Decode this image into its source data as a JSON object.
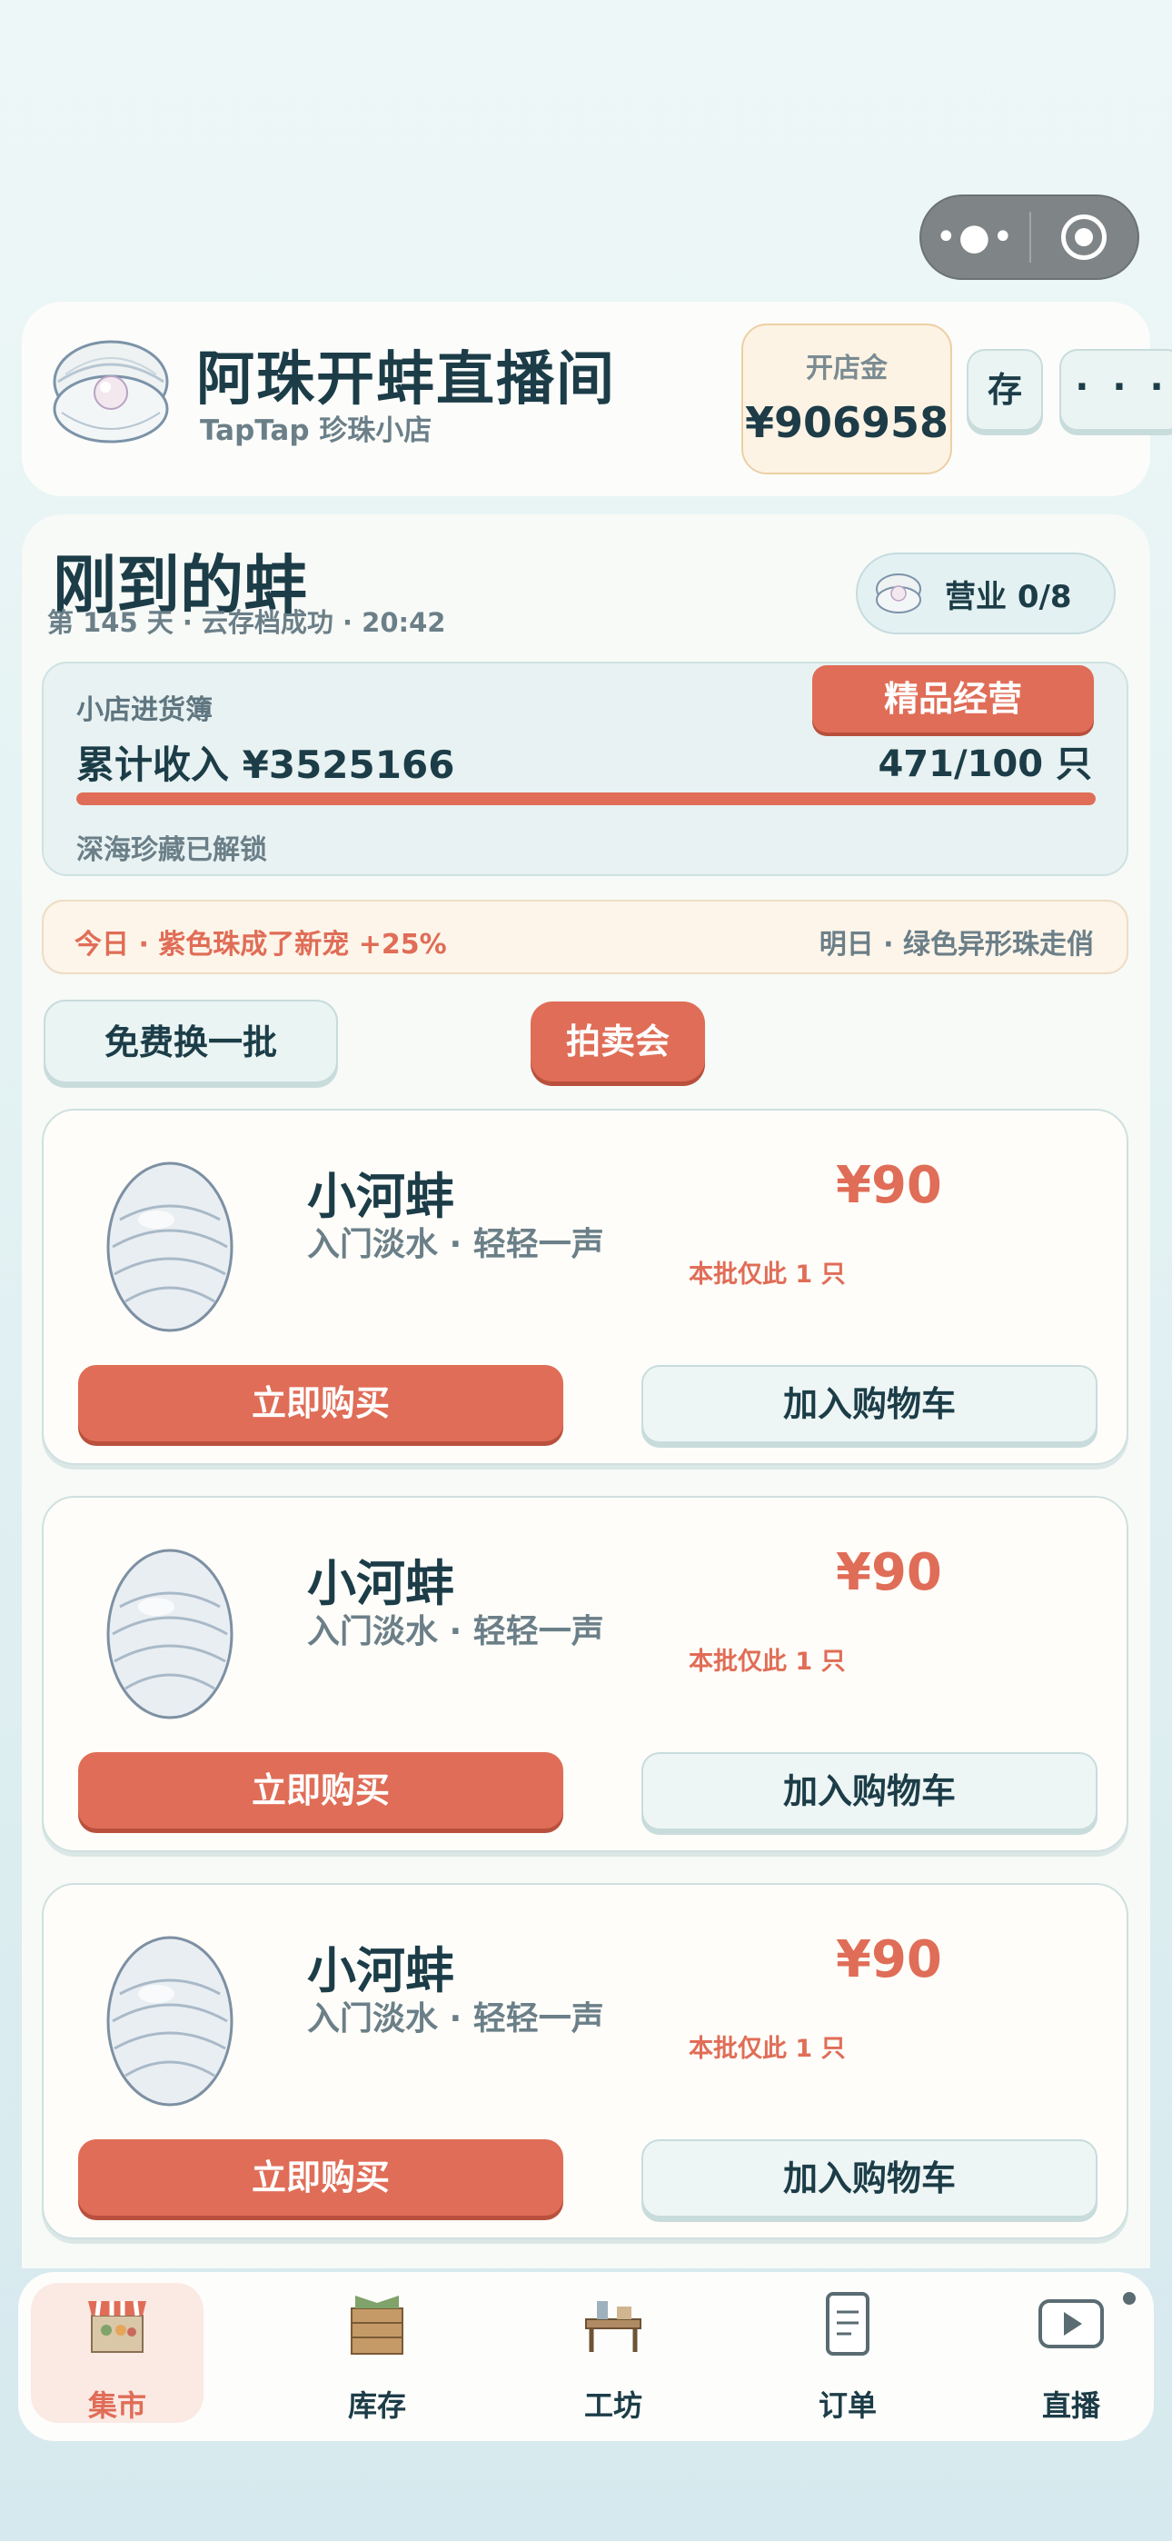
{
  "header": {
    "shop_title": "阿珠开蚌直播间",
    "shop_subtitle": "TapTap 珍珠小店",
    "gold_label": "开店金",
    "gold_value": "¥906958",
    "save_label": "存",
    "more_label": "· · ·"
  },
  "main": {
    "title": "刚到的蚌",
    "subtitle": "第 145 天 · 云存档成功 · 20:42",
    "business_badge": "营业 0/8"
  },
  "ledger": {
    "title": "小店进货簿",
    "income": "累计收入 ¥3525166",
    "tag": "精品经营",
    "count": "471/100 只",
    "progress": 1.0,
    "unlock_note": "深海珍藏已解锁"
  },
  "news": {
    "today": "今日 · 紫色珠成了新宠 +25%",
    "tomorrow": "明日 · 绿色异形珠走俏"
  },
  "actions": {
    "swap_label": "免费换一批",
    "auction_label": "拍卖会"
  },
  "items": [
    {
      "name": "小河蚌",
      "desc": "入门淡水 · 轻轻一声",
      "price": "¥90",
      "stock": "本批仅此 1 只",
      "buy_label": "立即购买",
      "cart_label": "加入购物车"
    },
    {
      "name": "小河蚌",
      "desc": "入门淡水 · 轻轻一声",
      "price": "¥90",
      "stock": "本批仅此 1 只",
      "buy_label": "立即购买",
      "cart_label": "加入购物车"
    },
    {
      "name": "小河蚌",
      "desc": "入门淡水 · 轻轻一声",
      "price": "¥90",
      "stock": "本批仅此 1 只",
      "buy_label": "立即购买",
      "cart_label": "加入购物车"
    }
  ],
  "tabs": [
    {
      "label": "集市",
      "icon": "market-stall-icon",
      "active": true
    },
    {
      "label": "库存",
      "icon": "crate-icon",
      "active": false
    },
    {
      "label": "工坊",
      "icon": "workbench-icon",
      "active": false
    },
    {
      "label": "订单",
      "icon": "document-icon",
      "active": false
    },
    {
      "label": "直播",
      "icon": "play-screen-icon",
      "active": false
    }
  ],
  "colors": {
    "accent": "#e06d57",
    "text_dark": "#1c3d48",
    "text_muted": "#6b7f88",
    "card_bg": "#fefdf9"
  }
}
